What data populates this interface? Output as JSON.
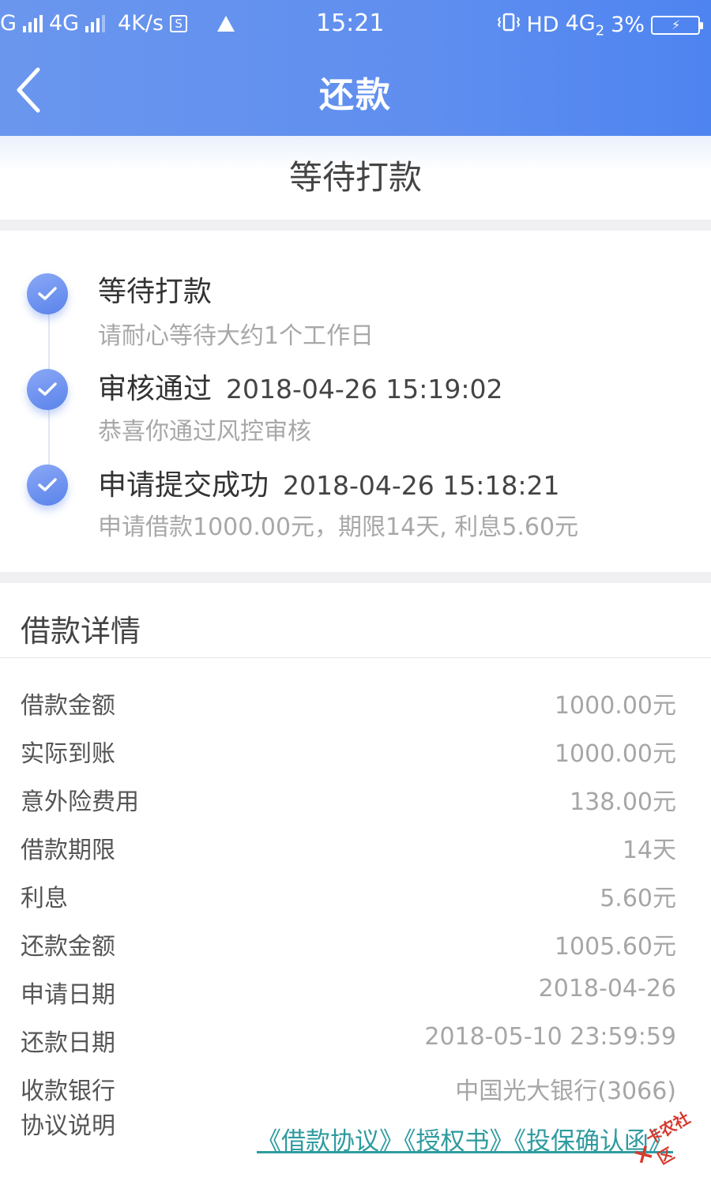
{
  "status_bar": {
    "net1": "G",
    "net2": "4G",
    "speed": "4K/s",
    "sim_glyph": "S",
    "time": "15:21",
    "hd": "HD",
    "net3": "4G",
    "net3_sub": "2",
    "battery": "3%"
  },
  "header": {
    "title": "还款",
    "back_icon": "chevron-left-icon"
  },
  "status": {
    "title": "等待打款"
  },
  "timeline": [
    {
      "title": "等待打款",
      "time": "",
      "subtitle": "请耐心等待大约1个工作日"
    },
    {
      "title": "审核通过",
      "time": "2018-04-26 15:19:02",
      "subtitle": "恭喜你通过风控审核"
    },
    {
      "title": "申请提交成功",
      "time": "2018-04-26 15:18:21",
      "subtitle": "申请借款1000.00元，期限14天, 利息5.60元"
    }
  ],
  "details": {
    "heading": "借款详情",
    "rows": [
      {
        "label": "借款金额",
        "value": "1000.00元"
      },
      {
        "label": "实际到账",
        "value": "1000.00元"
      },
      {
        "label": "意外险费用",
        "value": "138.00元"
      },
      {
        "label": "借款期限",
        "value": "14天"
      },
      {
        "label": "利息",
        "value": "5.60元"
      },
      {
        "label": "还款金额",
        "value": "1005.60元"
      },
      {
        "label": "申请日期",
        "value": "2018-04-26"
      },
      {
        "label": "还款日期",
        "value": "2018-05-10 23:59:59"
      },
      {
        "label": "收款银行",
        "value": "中国光大银行(3066)"
      }
    ],
    "agreement_label": "协议说明",
    "agreements": [
      "《借款协议》",
      "《授权书》",
      "《投保确认函》"
    ]
  },
  "watermark": {
    "text": "卡农社区"
  },
  "colors": {
    "header_start": "#6a96ee",
    "header_end": "#4e84f0",
    "timeline_dot": "#5a83ea",
    "link": "#2f9b9f",
    "value_gray": "#a6a6a6"
  }
}
